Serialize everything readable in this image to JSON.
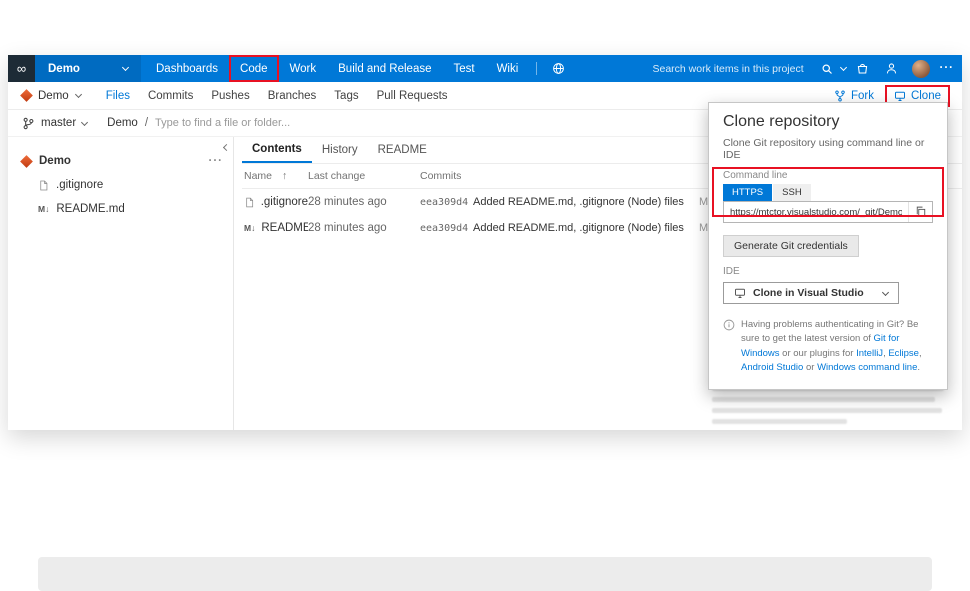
{
  "icons": {
    "logo": "∞",
    "more": "···",
    "sort_ascending": "↑",
    "markdown_badge": "M↓"
  },
  "topnav": {
    "project_label": "Demo",
    "items": [
      "Dashboards",
      "Code",
      "Work",
      "Build and Release",
      "Test",
      "Wiki"
    ],
    "search_placeholder": "Search work items in this project"
  },
  "toolbar": {
    "project_label": "Demo",
    "tabs": [
      "Files",
      "Commits",
      "Pushes",
      "Branches",
      "Tags",
      "Pull Requests"
    ],
    "fork_label": "Fork",
    "clone_label": "Clone"
  },
  "pathbar": {
    "branch": "master",
    "repo": "Demo",
    "separator": "/",
    "find_placeholder": "Type to find a file or folder..."
  },
  "sidebar": {
    "root_label": "Demo",
    "items": [
      {
        "name": ".gitignore"
      },
      {
        "name": "README.md"
      }
    ]
  },
  "main": {
    "tabs": [
      "Contents",
      "History",
      "README"
    ],
    "table": {
      "headers": {
        "name": "Name",
        "last_change": "Last change",
        "commits": "Commits"
      },
      "rows": [
        {
          "name": ".gitignore",
          "last_change": "28 minutes ago",
          "commit": "eea309d4",
          "message": "Added README.md, .gitignore (Node) files",
          "author": "Mark Franco"
        },
        {
          "name": "README.md",
          "last_change": "28 minutes ago",
          "commit": "eea309d4",
          "message": "Added README.md, .gitignore (Node) files",
          "author": "Mark Franco"
        }
      ]
    }
  },
  "clone_panel": {
    "title": "Clone repository",
    "subtitle": "Clone Git repository using command line or IDE",
    "command_line_label": "Command line",
    "tabs": [
      "HTTPS",
      "SSH"
    ],
    "url": "https://mtctor.visualstudio.com/_git/Demo",
    "generate_button_label": "Generate Git credentials",
    "ide_label": "IDE",
    "ide_button_label": "Clone in Visual Studio",
    "help_segments": [
      {
        "text": "Having problems authenticating in Git? Be sure to get the latest version of ",
        "link": false
      },
      {
        "text": "Git for Windows",
        "link": true
      },
      {
        "text": " or our plugins for ",
        "link": false
      },
      {
        "text": "IntelliJ",
        "link": true
      },
      {
        "text": ", ",
        "link": false
      },
      {
        "text": "Eclipse",
        "link": true
      },
      {
        "text": ", ",
        "link": false
      },
      {
        "text": "Android Studio",
        "link": true
      },
      {
        "text": " or ",
        "link": false
      },
      {
        "text": "Windows command line",
        "link": true
      },
      {
        "text": ".",
        "link": false
      }
    ]
  },
  "colors": {
    "accent_blue": "#0078d7",
    "annotation_red": "#e81123",
    "project_icon_orange": "#d9531e"
  }
}
